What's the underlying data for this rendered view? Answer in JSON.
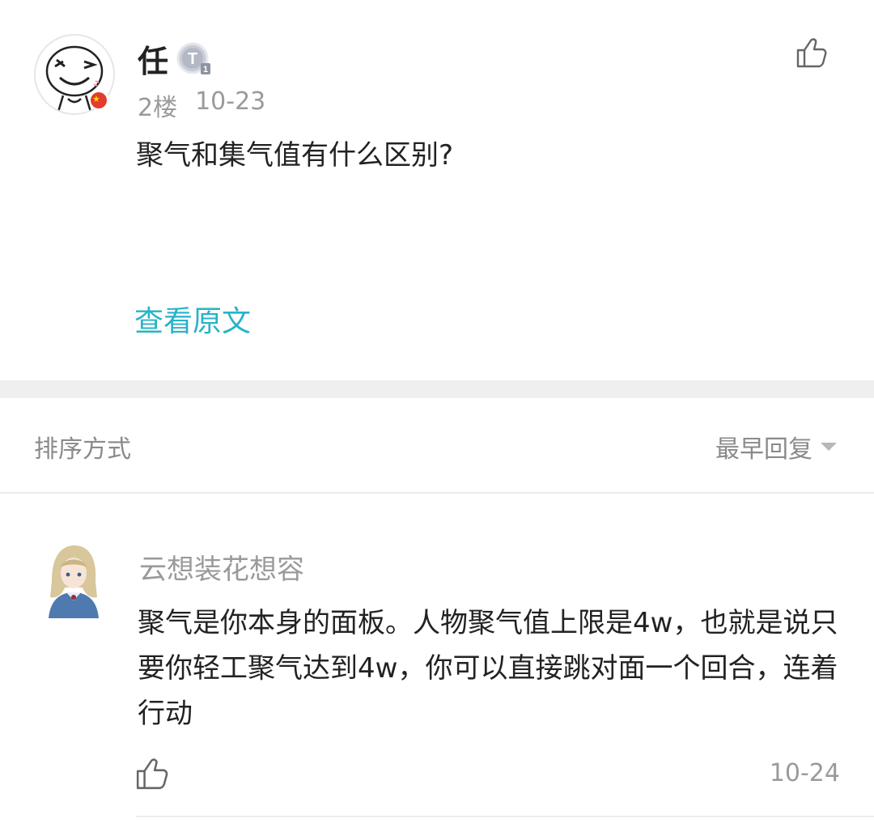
{
  "post": {
    "author": "任",
    "level_badge_letter": "T",
    "level_badge_number": "1",
    "floor": "2楼",
    "date": "10-23",
    "content": "聚气和集气值有什么区别?",
    "view_original": "查看原文"
  },
  "sort": {
    "label": "排序方式",
    "value": "最早回复"
  },
  "reply": {
    "author": "云想装花想容",
    "content": "聚气是你本身的面板。人物聚气值上限是4w，也就是说只要你轻工聚气达到4w，你可以直接跳对面一个回合，连着行动",
    "date": "10-24"
  },
  "colors": {
    "link": "#27b3c9",
    "meta": "#9a9a9a",
    "text": "#222222"
  },
  "icons": {
    "like": "thumbs-up-icon",
    "sort_caret": "caret-down-icon"
  }
}
